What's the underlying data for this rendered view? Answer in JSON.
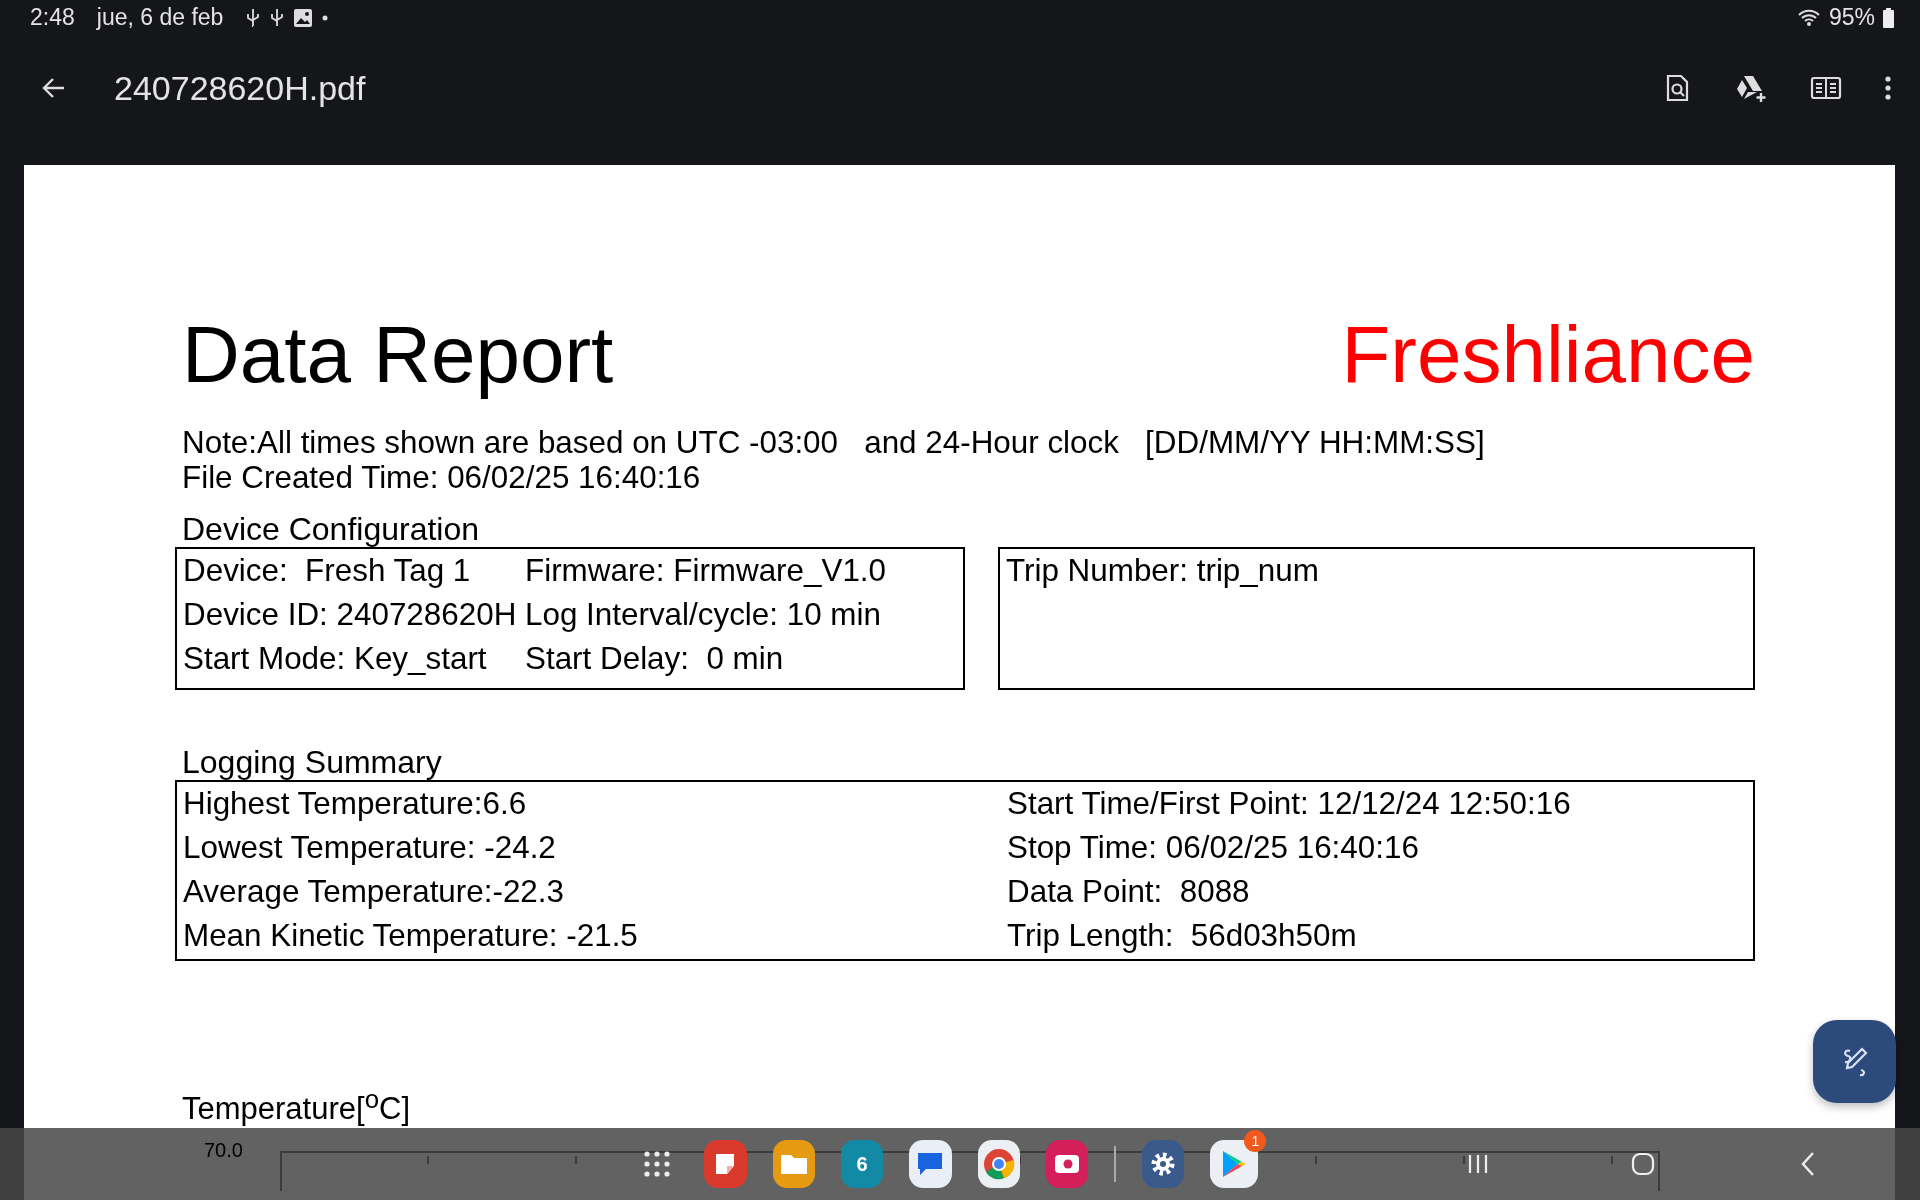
{
  "status_bar": {
    "time": "2:48",
    "date": "jue, 6 de feb",
    "battery": "95%"
  },
  "app_bar": {
    "title": "240728620H.pdf"
  },
  "document": {
    "title": "Data Report",
    "brand": "Freshliance",
    "note_lines": [
      "Note:All times shown are based on UTC -03:00   and 24-Hour clock   [DD/MM/YY HH:MM:SS]",
      "File Created Time: 06/02/25 16:40:16"
    ],
    "device_configuration": {
      "heading": "Device Configuration",
      "rows": [
        [
          "Device:  Fresh Tag 1",
          "Firmware: Firmware_V1.0"
        ],
        [
          "Device ID: 240728620H",
          "Log Interval/cycle: 10 min"
        ],
        [
          "Start Mode: Key_start",
          "Start Delay:  0 min"
        ]
      ],
      "trip_number": "Trip Number: trip_num"
    },
    "logging_summary": {
      "heading": "Logging Summary",
      "left": [
        "Highest Temperature:6.6",
        "Lowest Temperature: -24.2",
        "Average Temperature:-22.3",
        "Mean Kinetic Temperature: -21.5"
      ],
      "right": [
        "Start Time/First Point: 12/12/24 12:50:16",
        "Stop Time: 06/02/25 16:40:16",
        "Data Point:  8088",
        "Trip Length:  56d03h50m"
      ]
    },
    "temperature_chart": {
      "title": "Temperature[$^{o}$C]",
      "y_top_label": "70.0"
    }
  },
  "taskbar": {
    "apps": [
      {
        "kind": "grid"
      },
      {
        "kind": "notes"
      },
      {
        "kind": "files"
      },
      {
        "kind": "calendar",
        "label": "6"
      },
      {
        "kind": "messages"
      },
      {
        "kind": "browser"
      },
      {
        "kind": "camera"
      },
      {
        "kind": "divider"
      },
      {
        "kind": "settings"
      },
      {
        "kind": "store",
        "badge": "1"
      }
    ]
  }
}
